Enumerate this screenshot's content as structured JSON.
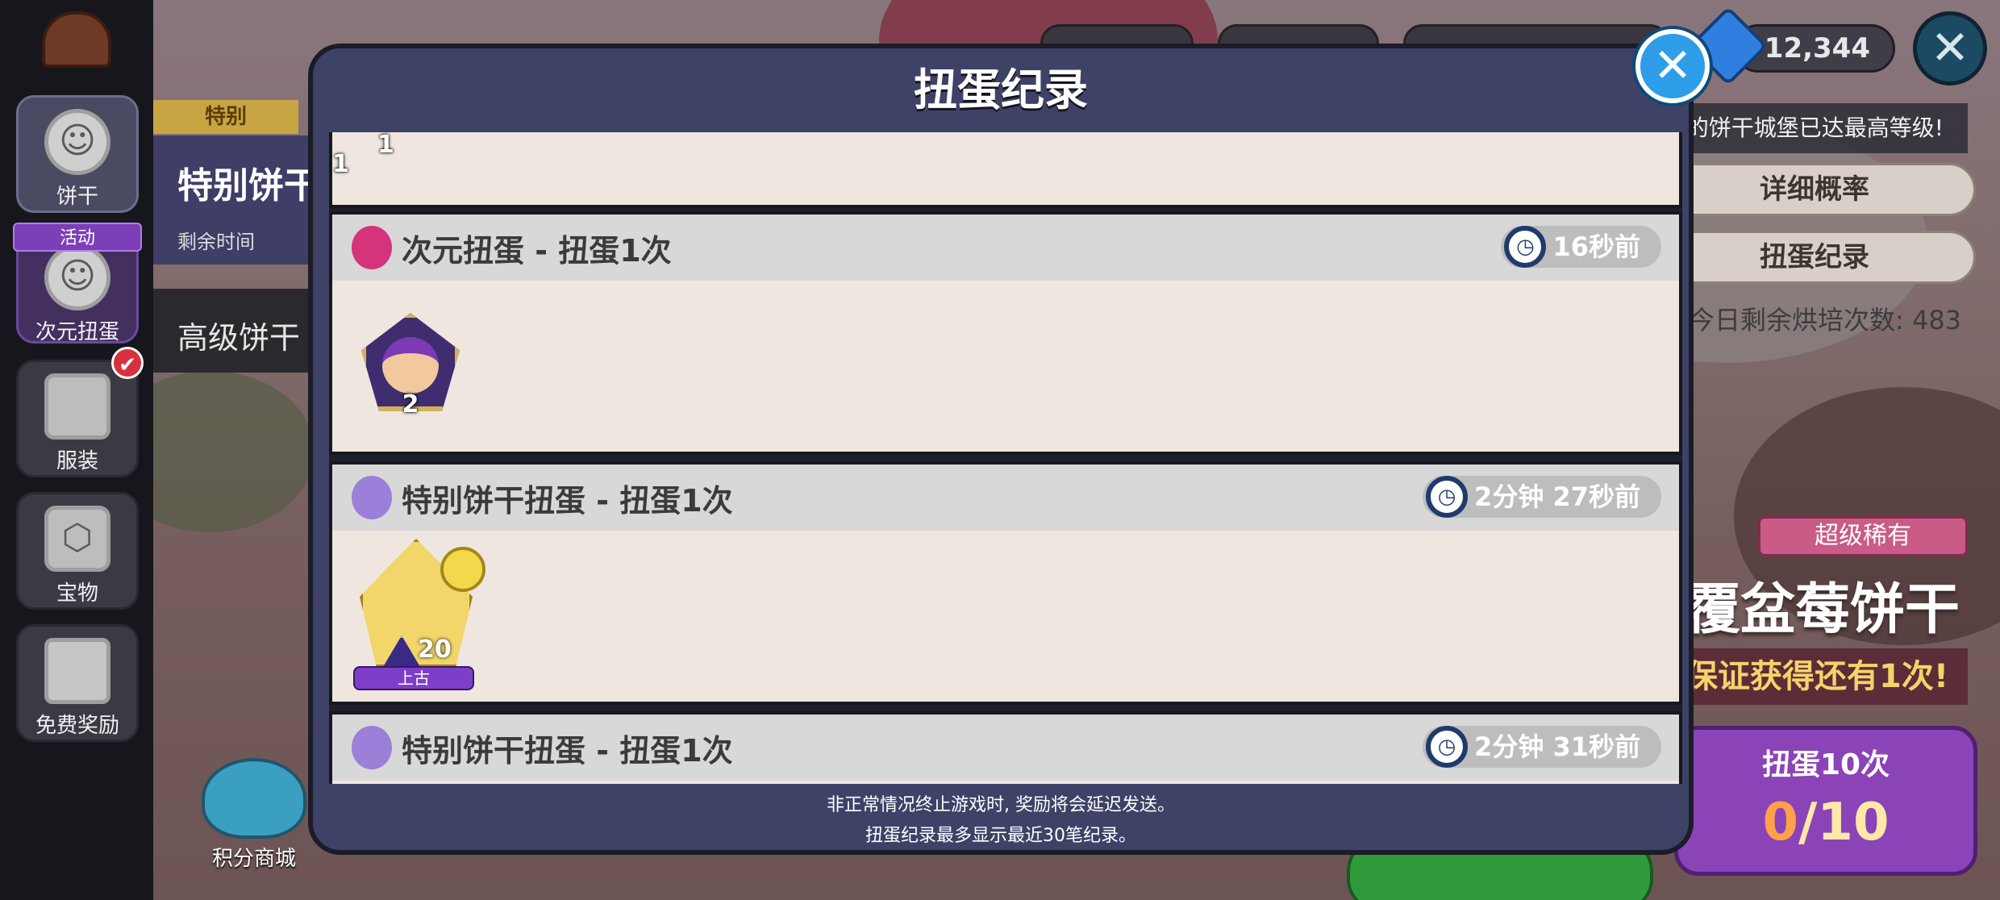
{
  "sidebar": {
    "items": [
      {
        "label": "饼干"
      },
      {
        "label": "次元扭蛋",
        "ribbon": "活动"
      },
      {
        "label": "服装"
      },
      {
        "label": "宝物"
      },
      {
        "label": "免费奖励"
      }
    ],
    "shop_label": "积分商城"
  },
  "behind": {
    "tag_special": "特别",
    "banner_title": "特别饼干",
    "remaining": "剩余时间",
    "advanced_title": "高级饼干"
  },
  "currency": {
    "gems": "12,344"
  },
  "right_panel": {
    "notice": "[种植园]的饼干城堡已达最高等级!",
    "detail_rate_button": "详细概率",
    "gacha_record_button": "扭蛋纪录",
    "bake_count": "今日剩余烘培次数: 483",
    "rarity": "超级稀有",
    "cookie_name": "覆盆莓饼干",
    "guarantee": "保证获得还有1次!",
    "draw10": {
      "label": "扭蛋10次",
      "count_current": "0",
      "count_sep": "/10"
    }
  },
  "modal": {
    "title": "扭蛋纪录",
    "records": [
      {
        "title": "",
        "time": "",
        "items": [
          {
            "type": "soulstone",
            "count": "1"
          }
        ]
      },
      {
        "title": "次元扭蛋 - 扭蛋1次",
        "time": "16秒前",
        "items": [
          {
            "type": "soulstone",
            "count": "2"
          }
        ]
      },
      {
        "title": "特别饼干扭蛋 - 扭蛋1次",
        "time": "2分钟 27秒前",
        "items": [
          {
            "type": "cookie",
            "level": "20",
            "grade": "上古"
          }
        ]
      },
      {
        "title": "特别饼干扭蛋 - 扭蛋1次",
        "time": "2分钟 31秒前",
        "items": []
      }
    ],
    "footer": [
      "非正常情况终止游戏时, 奖励将会延迟发送。",
      "扭蛋纪录最多显示最近30笔纪录。"
    ]
  },
  "colors": {
    "modal_bg": "#3e4266",
    "card_bg": "#efe7df",
    "card_header": "#d8d8d8",
    "close_blue": "#2e9ee8",
    "ancient_purple": "#7d3fc8"
  },
  "icons": [
    "castle-icon",
    "cookie-icon",
    "dimension-gacha-icon",
    "shirt-icon",
    "treasure-icon",
    "gift-icon",
    "gem-icon",
    "close-icon",
    "clock-icon",
    "soulstone-icon",
    "pig-shop-icon"
  ]
}
